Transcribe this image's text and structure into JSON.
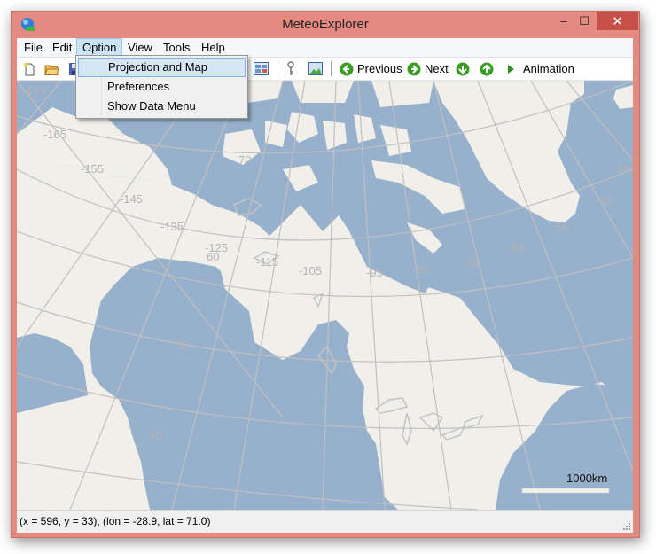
{
  "window": {
    "title": "MeteoExplorer",
    "controls": {
      "minimize": "–",
      "maximize": "☐",
      "close": "✕"
    }
  },
  "menubar": {
    "items": [
      {
        "label": "File"
      },
      {
        "label": "Edit"
      },
      {
        "label": "Option",
        "active": true
      },
      {
        "label": "View"
      },
      {
        "label": "Tools"
      },
      {
        "label": "Help"
      }
    ]
  },
  "dropdown": {
    "items": [
      {
        "label": "Projection and Map",
        "highlighted": true
      },
      {
        "label": "Preferences"
      },
      {
        "label": "Show Data Menu"
      }
    ]
  },
  "toolbar": {
    "icons": [
      "new-file-icon",
      "open-folder-icon",
      "save-icon",
      "layout-grid-icon",
      "key-icon",
      "picture-icon"
    ],
    "previous_label": "Previous",
    "next_label": "Next",
    "animation_label": "Animation"
  },
  "map": {
    "longitude_labels": [
      "-175",
      "-165",
      "-155",
      "-145",
      "-135",
      "-125",
      "-115",
      "-105",
      "-95",
      "-85",
      "-75",
      "-65",
      "-55",
      "-45",
      "-35"
    ],
    "latitude_labels": [
      "70",
      "60",
      "50",
      "40"
    ],
    "scale_label": "1000km",
    "colors": {
      "water": "#97b1cc",
      "land": "#f1efe9",
      "grid": "#c0c0c0",
      "label": "#b4b4b4"
    }
  },
  "statusbar": {
    "text": "(x = 596, y = 33), (lon = -28.9, lat = 71.0)"
  },
  "colors": {
    "frame": "#e58a80",
    "close_button": "#c7504b",
    "menu_highlight": "#cce4f7",
    "nav_green": "#3a9d23"
  }
}
